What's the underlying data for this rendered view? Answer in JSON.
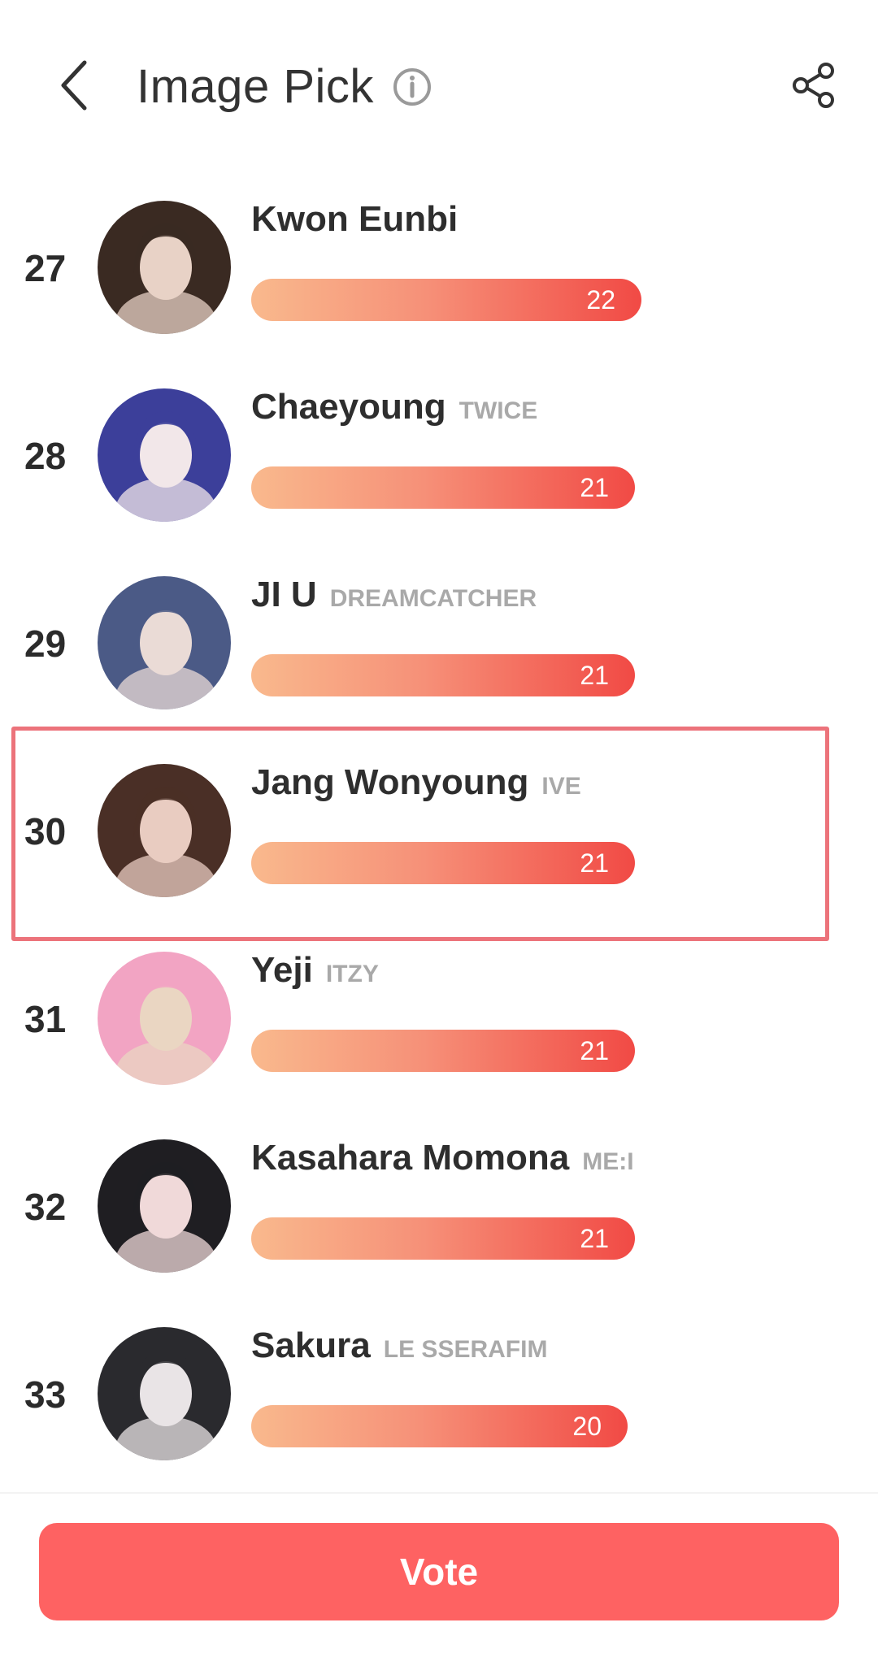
{
  "header": {
    "title": "Image Pick",
    "back_icon": "chevron-left-icon",
    "info_icon": "info-circle-icon",
    "share_icon": "share-icon"
  },
  "ranking": [
    {
      "rank": "27",
      "name": "Kwon Eunbi",
      "group": "",
      "votes": "22",
      "bar_fraction": 1.0,
      "avatar_colors": [
        "#3a2a22",
        "#e8d2c6"
      ]
    },
    {
      "rank": "28",
      "name": "Chaeyoung",
      "group": "TWICE",
      "votes": "21",
      "bar_fraction": 0.984,
      "avatar_colors": [
        "#3c3f9a",
        "#f2e7e9"
      ]
    },
    {
      "rank": "29",
      "name": "JI U",
      "group": "DREAMCATCHER",
      "votes": "21",
      "bar_fraction": 0.984,
      "avatar_colors": [
        "#4b5a86",
        "#eadbd6"
      ]
    },
    {
      "rank": "30",
      "name": "Jang Wonyoung",
      "group": "IVE",
      "votes": "21",
      "bar_fraction": 0.984,
      "avatar_colors": [
        "#4a2f26",
        "#e9ccc1"
      ]
    },
    {
      "rank": "31",
      "name": "Yeji",
      "group": "ITZY",
      "votes": "21",
      "bar_fraction": 0.984,
      "avatar_colors": [
        "#f2a4c3",
        "#ead6c2"
      ]
    },
    {
      "rank": "32",
      "name": "Kasahara Momona",
      "group": "ME:I",
      "votes": "21",
      "bar_fraction": 0.984,
      "avatar_colors": [
        "#1f1e22",
        "#f0d9d9"
      ]
    },
    {
      "rank": "33",
      "name": "Sakura",
      "group": "LE SSERAFIM",
      "votes": "20",
      "bar_fraction": 0.964,
      "avatar_colors": [
        "#2a2a2e",
        "#e9e4e6"
      ]
    }
  ],
  "highlighted_rank": "30",
  "colors": {
    "accent": "#fe6262",
    "highlight_border": "#ec737b",
    "bar_start": "#f9b98d",
    "bar_end": "#f14a45"
  },
  "footer": {
    "vote_label": "Vote"
  }
}
